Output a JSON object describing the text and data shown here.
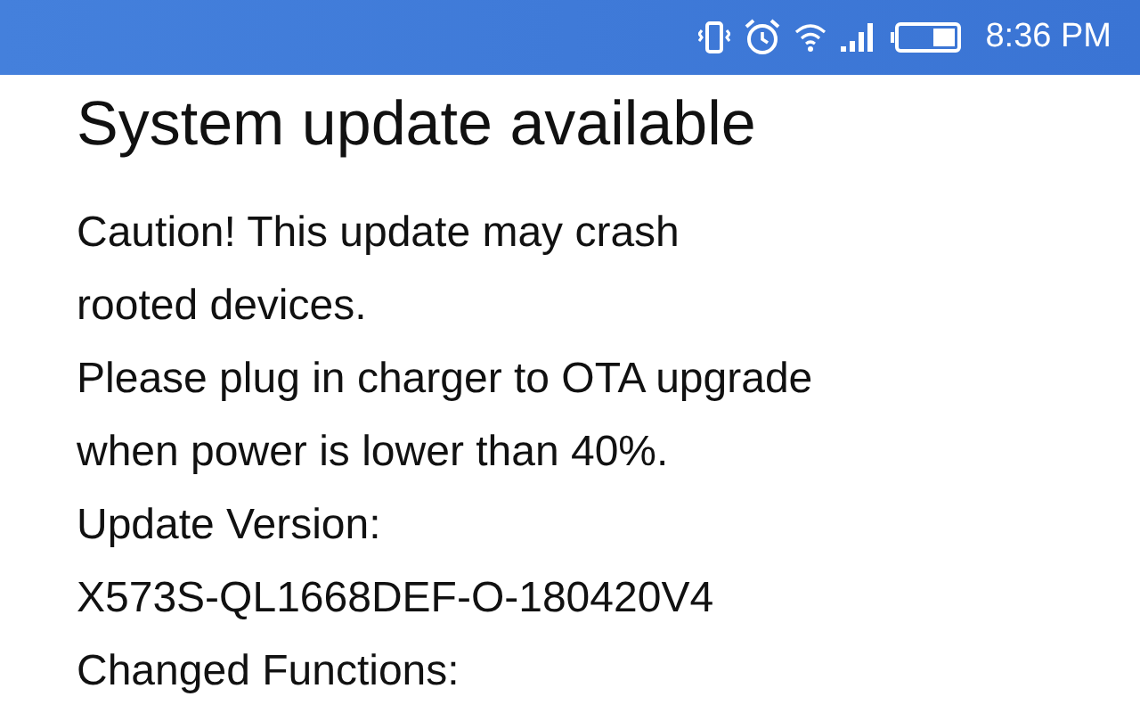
{
  "status_bar": {
    "time": "8:36 PM"
  },
  "title": "System update available",
  "lines": [
    "Caution! This update may crash",
    "rooted devices.",
    "Please plug in charger to OTA upgrade",
    "when power is lower than 40%.",
    "Update Version:",
    "X573S-QL1668DEF-O-180420V4",
    "Changed Functions:"
  ]
}
